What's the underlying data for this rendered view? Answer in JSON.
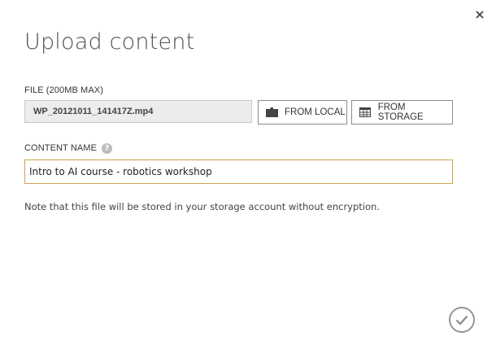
{
  "dialog": {
    "title": "Upload content",
    "file": {
      "label": "FILE (200MB MAX)",
      "value": "WP_20121011_141417Z.mp4"
    },
    "buttons": {
      "from_local": "FROM LOCAL",
      "from_storage": "FROM STORAGE"
    },
    "content_name": {
      "label": "CONTENT NAME",
      "help_glyph": "?",
      "value": "Intro to AI course - robotics workshop"
    },
    "note": "Note that this file will be stored in your storage account without encryption."
  },
  "icons": {
    "close": "close-icon",
    "folder": "folder-icon",
    "storage_grid": "grid-icon",
    "help": "help-icon",
    "confirm": "checkmark-icon"
  },
  "colors": {
    "input_focus_border": "#d0a44a",
    "file_field_bg": "#ececec",
    "button_border": "#8c8c8c",
    "icon_gray": "#444444"
  }
}
